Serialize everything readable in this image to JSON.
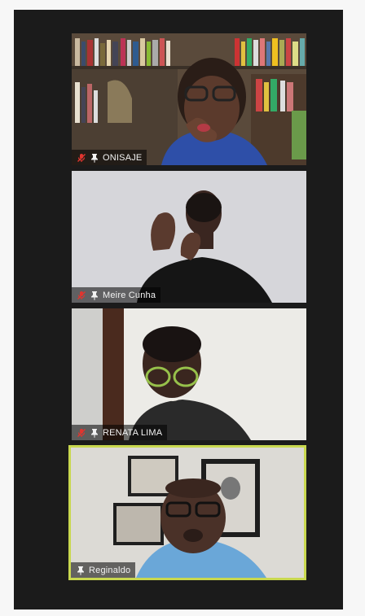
{
  "participants": [
    {
      "name": "ONISAJE",
      "muted": true,
      "speaking": false
    },
    {
      "name": "Meire Cunha",
      "muted": true,
      "speaking": false
    },
    {
      "name": "RENATA LIMA",
      "muted": true,
      "speaking": false
    },
    {
      "name": "Reginaldo",
      "muted": false,
      "speaking": true
    }
  ],
  "colors": {
    "frame": "#1b1b1b",
    "active_speaker_border": "#c9d84f",
    "mute_icon": "#e0352f"
  },
  "icons": {
    "muted": "mic-muted-icon",
    "pin": "pin-icon"
  }
}
